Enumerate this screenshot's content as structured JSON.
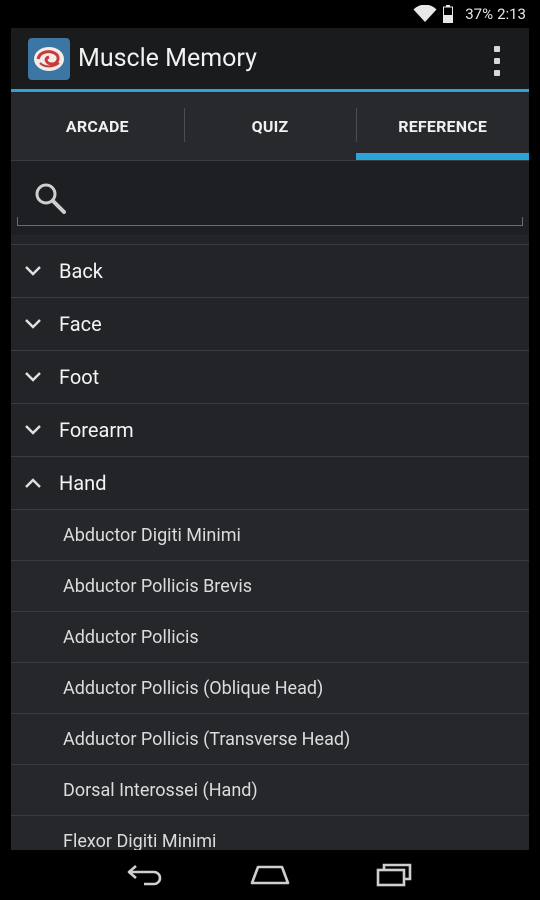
{
  "status_bar": {
    "battery_percent": "37%",
    "time": "2:13",
    "icons": [
      "wifi-icon",
      "battery-icon"
    ]
  },
  "action_bar": {
    "title": "Muscle Memory",
    "app_icon": "brain-app-icon",
    "overflow_icon": "overflow-menu-icon"
  },
  "tabs": [
    {
      "label": "ARCADE",
      "selected": false
    },
    {
      "label": "QUIZ",
      "selected": false
    },
    {
      "label": "REFERENCE",
      "selected": true
    }
  ],
  "search": {
    "value": "",
    "placeholder": "",
    "icon": "search-icon"
  },
  "groups": [
    {
      "label": "Back",
      "expanded": false
    },
    {
      "label": "Face",
      "expanded": false
    },
    {
      "label": "Foot",
      "expanded": false
    },
    {
      "label": "Forearm",
      "expanded": false
    },
    {
      "label": "Hand",
      "expanded": true
    }
  ],
  "hand_items": [
    "Abductor Digiti Minimi",
    "Abductor Pollicis Brevis",
    "Adductor Pollicis",
    "Adductor Pollicis (Oblique Head)",
    "Adductor Pollicis (Transverse Head)",
    "Dorsal Interossei (Hand)",
    "Flexor Digiti Minimi"
  ],
  "nav_bar": {
    "buttons": [
      "back-icon",
      "home-icon",
      "recent-apps-icon"
    ]
  },
  "colors": {
    "accent": "#2aa5d8",
    "background": "#222427",
    "action_bar": "#1a1b1d"
  }
}
